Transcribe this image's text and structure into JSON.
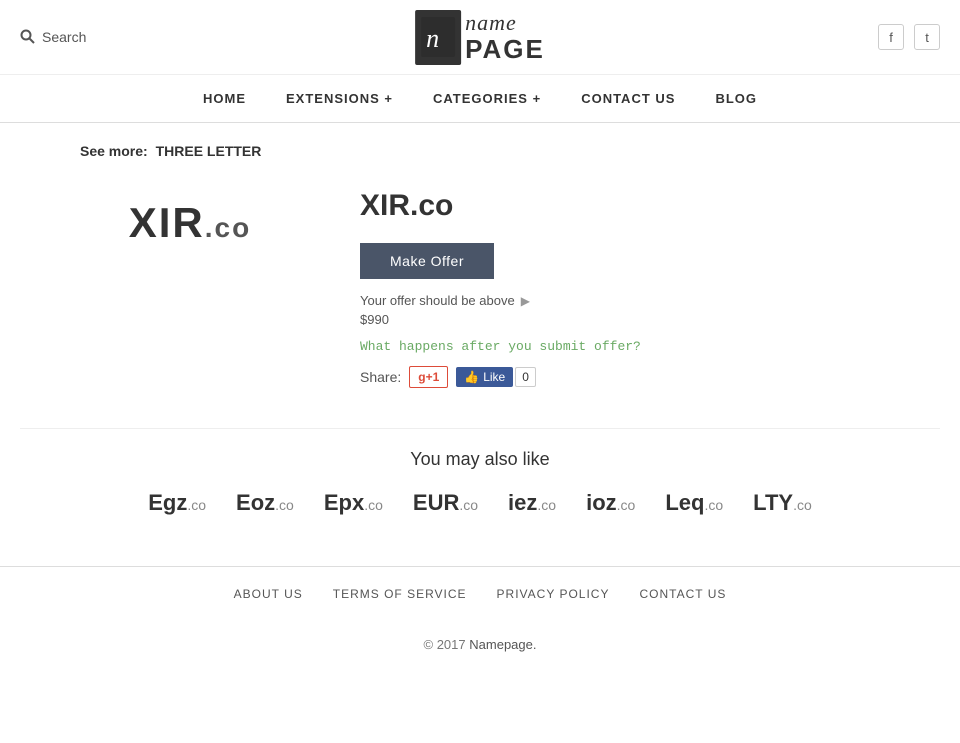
{
  "header": {
    "search_label": "Search",
    "logo_icon_text": "n",
    "logo_name": "name",
    "logo_page": "PAGE",
    "social": {
      "facebook_label": "f",
      "twitter_label": "t"
    }
  },
  "nav": {
    "items": [
      {
        "label": "HOME",
        "id": "home"
      },
      {
        "label": "EXTENSIONS +",
        "id": "extensions"
      },
      {
        "label": "CATEGORIES +",
        "id": "categories"
      },
      {
        "label": "CONTACT US",
        "id": "contact"
      },
      {
        "label": "BLOG",
        "id": "blog"
      }
    ]
  },
  "breadcrumb": {
    "prefix": "See more:",
    "link_text": "THREE LETTER"
  },
  "product": {
    "logo_main": "XIR",
    "logo_suffix": ".co",
    "title": "XIR.co",
    "make_offer_label": "Make Offer",
    "offer_info": "Your offer should be above",
    "offer_amount": "$990",
    "what_happens": "What happens after you submit offer?",
    "share_label": "Share:",
    "gplus_label": "g+1",
    "fb_like_label": "Like",
    "fb_count": "0"
  },
  "also_like": {
    "title": "You may also like",
    "items": [
      {
        "domain": "Egz",
        "tld": ".co"
      },
      {
        "domain": "Eoz",
        "tld": ".co"
      },
      {
        "domain": "Epx",
        "tld": ".co"
      },
      {
        "domain": "EUR",
        "tld": ".co"
      },
      {
        "domain": "iez",
        "tld": ".co"
      },
      {
        "domain": "ioz",
        "tld": ".co"
      },
      {
        "domain": "Leq",
        "tld": ".co"
      },
      {
        "domain": "LTY",
        "tld": ".co"
      }
    ]
  },
  "footer": {
    "links": [
      {
        "label": "ABOUT US",
        "id": "about"
      },
      {
        "label": "TERMS OF SERVICE",
        "id": "terms"
      },
      {
        "label": "PRIVACY POLICY",
        "id": "privacy"
      },
      {
        "label": "CONTACT US",
        "id": "contact"
      }
    ],
    "copy": "© 2017",
    "brand": "Namepage."
  }
}
